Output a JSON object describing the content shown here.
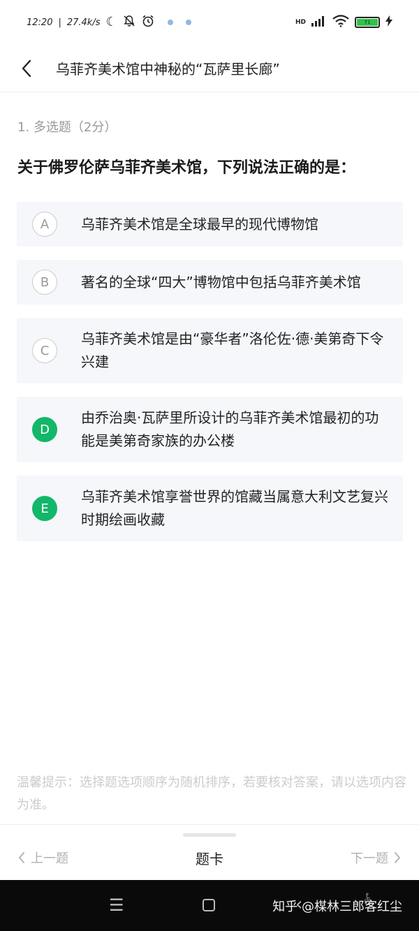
{
  "status_bar": {
    "time": "12:20",
    "speed": "27.4k/s",
    "network": "HD",
    "battery_label": "71",
    "icons": [
      "moon-icon",
      "bell-off-icon",
      "alarm-icon",
      "signal-icon",
      "wifi-icon",
      "battery-icon",
      "charging-icon"
    ]
  },
  "header": {
    "title": "乌菲齐美术馆中神秘的“瓦萨里长廊”"
  },
  "question": {
    "meta": "1. 多选题（2分）",
    "text": "关于佛罗伦萨乌菲齐美术馆，下列说法正确的是："
  },
  "options": [
    {
      "letter": "A",
      "text": "乌菲齐美术馆是全球最早的现代博物馆",
      "selected": false
    },
    {
      "letter": "B",
      "text": "著名的全球“四大”博物馆中包括乌菲齐美术馆",
      "selected": false
    },
    {
      "letter": "C",
      "text": "乌菲齐美术馆是由“豪华者”洛伦佐·德·美第奇下令兴建",
      "selected": false
    },
    {
      "letter": "D",
      "text": "由乔治奥·瓦萨里所设计的乌菲齐美术馆最初的功能是美第奇家族的办公楼",
      "selected": true
    },
    {
      "letter": "E",
      "text": "乌菲齐美术馆享誉世界的馆藏当属意大利文艺复兴时期绘画收藏",
      "selected": true
    }
  ],
  "hint": "温馨提示：选择题选项顺序为随机排序，若要核对答案，请以选项内容为准。",
  "bottom": {
    "prev_label": "上一题",
    "card_label": "题卡",
    "next_label": "下一题"
  },
  "watermark": "知乎 @楳林三郎客红尘",
  "colors": {
    "accent": "#12b76a",
    "option_bg": "#f5f7fa",
    "muted_text": "#999999"
  }
}
